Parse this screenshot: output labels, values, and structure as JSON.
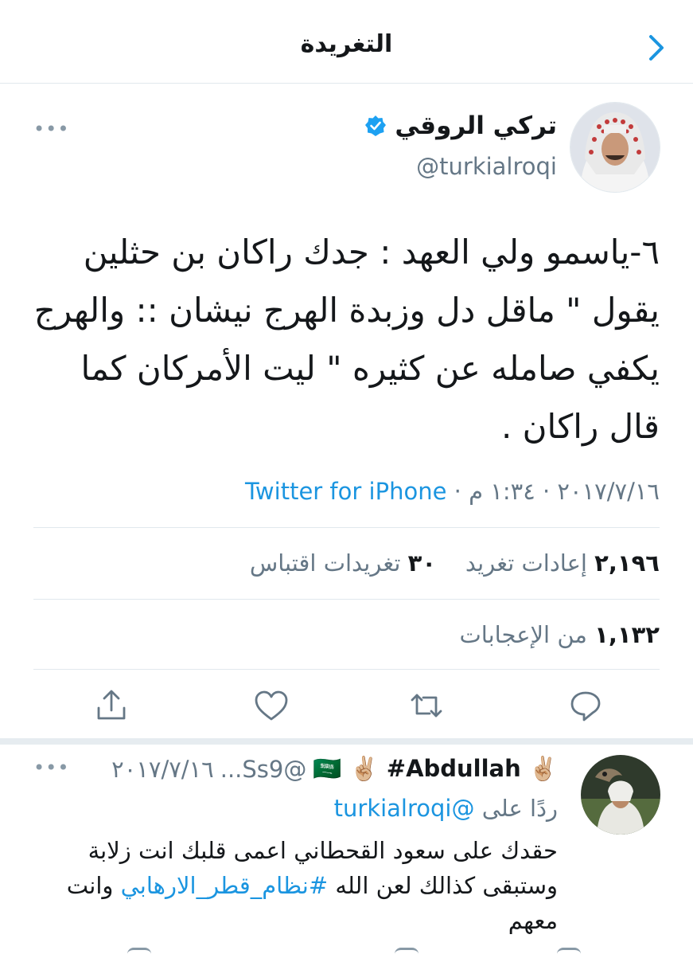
{
  "header": {
    "title": "التغريدة"
  },
  "tweet": {
    "author_name": "تركي الروقي",
    "handle": "@turkialroqi",
    "text": "٦-ياسمو ولي العهد : جدك راكان بن حثلين يقول \" ماقل دل وزبدة الهرج نيشان :: والهرج يكفي صامله عن كثيره \" ليت الأمركان كما قال راكان .",
    "date": "٢٠١٧/٧/١٦",
    "separator": "·",
    "time": "١:٣٤ م",
    "source": "Twitter for iPhone",
    "retweets_count": "٢,١٩٦",
    "retweets_label": "إعادات تغريد",
    "quotes_count": "٣٠",
    "quotes_label": "تغريدات اقتباس",
    "likes_count": "١,١٣٢",
    "likes_label": "من الإعجابات"
  },
  "icons": {
    "back": "chevron-left-icon",
    "more": "more-dots-icon",
    "verified": "verified-badge-icon",
    "reply": "reply-icon",
    "retweet": "retweet-icon",
    "like": "heart-icon",
    "share": "share-icon"
  },
  "reply": {
    "author_name": "✌🏼 🇸🇦 ✌🏼 #Abdullah",
    "handle_trunc": "@Ss9...",
    "date": "٢٠١٧/٧/١٦",
    "replying_prefix": "ردًا على",
    "replying_to": "@turkialroqi",
    "text_main": "حقدك على سعود القحطاني اعمى قلبك انت زلابة وستبقى كذالك لعن الله",
    "hashtag": "#نظام_قطر_الارهابي",
    "text_end": "وانت معهم"
  },
  "colors": {
    "accent": "#1b95e0",
    "grey": "#657786",
    "border": "#e1e8ed"
  }
}
